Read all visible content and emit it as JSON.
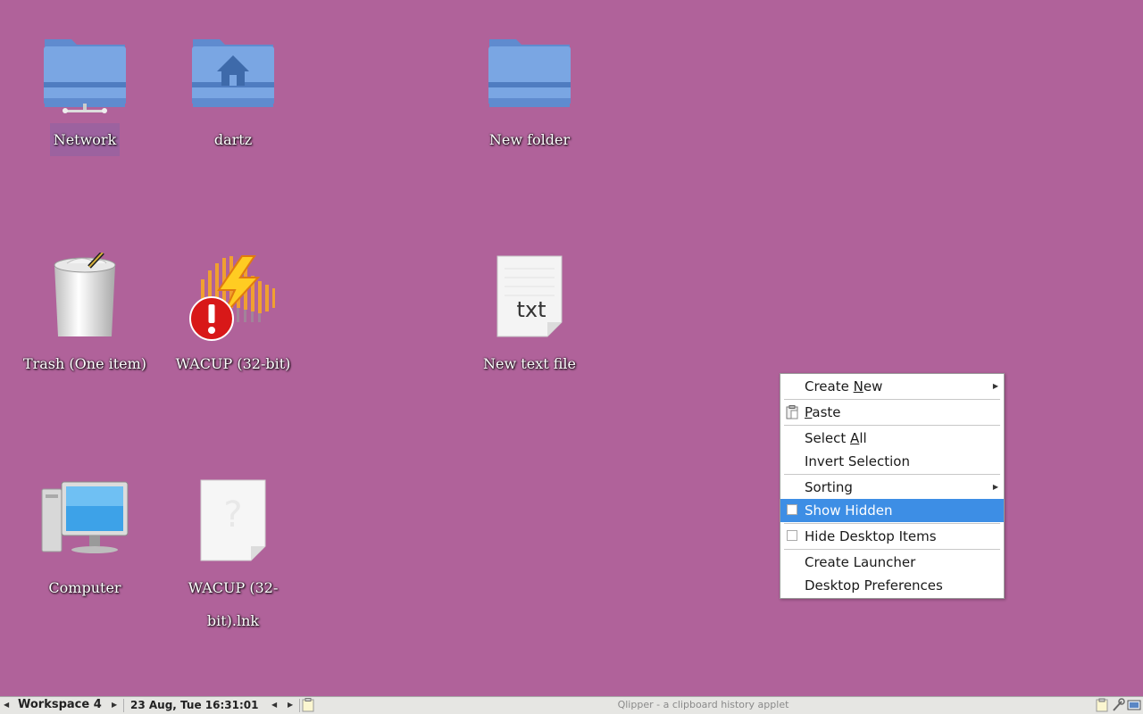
{
  "desktop": {
    "icons": [
      {
        "label": "Network",
        "icon": "network-folder-icon"
      },
      {
        "label": "dartz",
        "icon": "home-folder-icon"
      },
      {
        "label": "New folder",
        "icon": "folder-icon"
      },
      {
        "label": "Trash (One item)",
        "icon": "trash-full-icon"
      },
      {
        "label": "WACUP (32-bit)",
        "icon": "wacup-broken-icon"
      },
      {
        "label": "New text file",
        "icon": "text-file-icon"
      },
      {
        "label": "Computer",
        "icon": "computer-icon"
      },
      {
        "label": "WACUP (32-bit).lnk",
        "icon": "unknown-file-icon"
      }
    ]
  },
  "context_menu": {
    "items": [
      {
        "label_pre": "Create ",
        "label_ul": "N",
        "label_post": "ew",
        "submenu": true
      },
      {
        "label_pre": "",
        "label_ul": "P",
        "label_post": "aste",
        "icon": "paste-icon"
      },
      {
        "label_pre": "Select ",
        "label_ul": "A",
        "label_post": "ll"
      },
      {
        "label": "Invert Selection"
      },
      {
        "label": "Sorting",
        "submenu": true
      },
      {
        "label": "Show Hidden",
        "checkbox": true,
        "checked": false,
        "highlighted": true
      },
      {
        "label": "Hide Desktop Items",
        "checkbox": true,
        "checked": false
      },
      {
        "label": "Create Launcher"
      },
      {
        "label": "Desktop Preferences"
      }
    ],
    "highlight_color": "#3d8ee5"
  },
  "taskbar": {
    "workspace": "Workspace 4",
    "clock": "23 Aug, Tue 16:31:01",
    "task_tooltip": "Qlipper - a clipboard history applet"
  },
  "colors": {
    "desktop_bg": "#b0629a",
    "folder_blue": "#6f9ad8"
  }
}
